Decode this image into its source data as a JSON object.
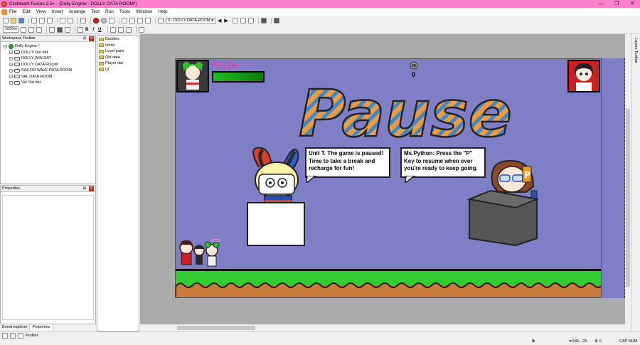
{
  "window": {
    "title": "Clickteam Fusion 2.5+ - [Dolly Engine - DOLLY DATA ROOM*]",
    "controls": [
      "—",
      "❐",
      "✕"
    ]
  },
  "menu": [
    "File",
    "Edit",
    "View",
    "Insert",
    "Arrange",
    "Text",
    "Run",
    "Tools",
    "Window",
    "Help"
  ],
  "toolbar": {
    "frame_select": "3 - DOLLY DATA ROOM",
    "zoom": "100%",
    "bold": "B",
    "italic": "I",
    "underline": "U"
  },
  "workspace_panel": {
    "title": "Workspace Toolbar",
    "root": "Dolly Engine *",
    "frames": [
      "DOLLY Out dat",
      "DOLLY WIN DAT",
      "DOLLY DATA ROOM",
      "SAILOR WAVE DATA ROOM",
      "VAL DATA ROOM",
      "Val Out dat"
    ]
  },
  "folders_panel": {
    "items": [
      "Baddies",
      "Items",
      "Level parts",
      "Old data",
      "Player dat",
      "UI"
    ]
  },
  "properties_panel": {
    "title": "Properties"
  },
  "bottom_tabs": [
    "Event explorer",
    "Properties"
  ],
  "status": {
    "profiler": "Profiler",
    "coords": "545, -29",
    "count": "0",
    "caps": "CAP NUM"
  },
  "layers_toolbar": "Layers Toolbar",
  "game": {
    "life_label": "Life",
    "life_fraction": 1.0,
    "score": "0",
    "pause_title": "Pause",
    "bubble_left": "Unit T. The game is paused! Time to take a break and recharge for fun!",
    "bubble_right": "Ms.Python: Press the \"P\" Key to resume when ever you're ready to keep going.",
    "colors": {
      "background": "#7f7fc8",
      "grass": "#33cc33",
      "dirt": "#c87a3a",
      "pause_fill": "#f09a3a",
      "pause_stripe": "#3a8ad0",
      "life_text": "#ff33aa"
    }
  }
}
